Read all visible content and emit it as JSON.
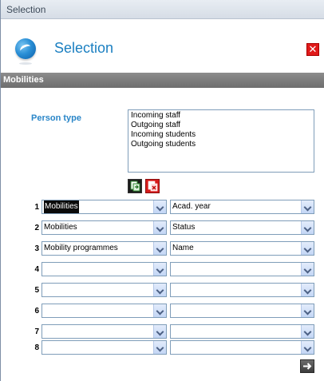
{
  "window": {
    "title": "Selection"
  },
  "header": {
    "title": "Selection",
    "icon": "app-logo-icon",
    "close_icon": "close-icon"
  },
  "section": {
    "title": "Mobilities"
  },
  "person_type": {
    "label": "Person type",
    "options": [
      "Incoming staff",
      "Outgoing staff",
      "Incoming students",
      "Outgoing students"
    ]
  },
  "buttons": {
    "copy_icon": "copy-icon",
    "remove_icon": "remove-icon",
    "next_icon": "arrow-right-icon"
  },
  "criteria": [
    {
      "num": "1",
      "left": "Mobilities",
      "right": "Acad. year"
    },
    {
      "num": "2",
      "left": "Mobilities",
      "right": "Status"
    },
    {
      "num": "3",
      "left": "Mobility programmes",
      "right": "Name"
    },
    {
      "num": "4",
      "left": "",
      "right": ""
    },
    {
      "num": "5",
      "left": "",
      "right": ""
    },
    {
      "num": "6",
      "left": "",
      "right": ""
    },
    {
      "num": "7",
      "left": "",
      "right": ""
    },
    {
      "num": "8",
      "left": "",
      "right": ""
    }
  ],
  "colors": {
    "accent": "#1a7fc1",
    "label": "#2a86c8",
    "section_bar": "#7a7a7a",
    "close": "#e01a1a"
  }
}
